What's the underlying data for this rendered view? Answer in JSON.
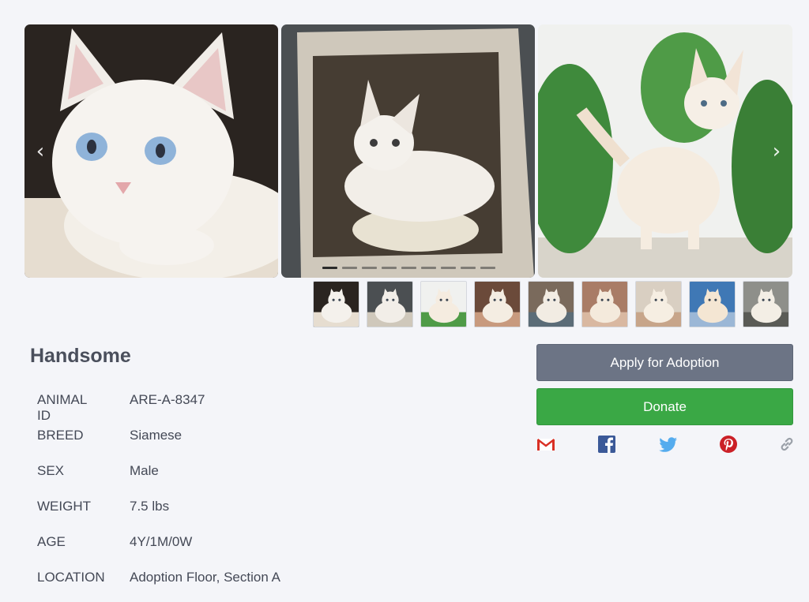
{
  "pet": {
    "name": "Handsome",
    "details": [
      {
        "label": "ANIMAL ID",
        "value": "ARE-A-8347"
      },
      {
        "label": "BREED",
        "value": "Siamese"
      },
      {
        "label": "SEX",
        "value": "Male"
      },
      {
        "label": "WEIGHT",
        "value": "7.5 lbs"
      },
      {
        "label": "AGE",
        "value": "4Y/1M/0W"
      },
      {
        "label": "LOCATION",
        "value": "Adoption Floor, Section A"
      }
    ]
  },
  "gallery": {
    "prev_icon": "chevron-left-icon",
    "next_icon": "chevron-right-icon",
    "dot_count": 9,
    "active_dot": 0,
    "thumbnail_count": 9
  },
  "actions": {
    "apply_label": "Apply for Adoption",
    "donate_label": "Donate"
  },
  "share": {
    "icons": [
      "gmail-icon",
      "facebook-icon",
      "twitter-icon",
      "pinterest-icon",
      "link-icon"
    ]
  },
  "colors": {
    "background": "#f4f5f9",
    "apply_button": "#6c7485",
    "donate_button": "#3aa845",
    "facebook": "#3b5998",
    "twitter": "#55acee",
    "pinterest": "#cb2027",
    "link": "#9aa0a8"
  }
}
